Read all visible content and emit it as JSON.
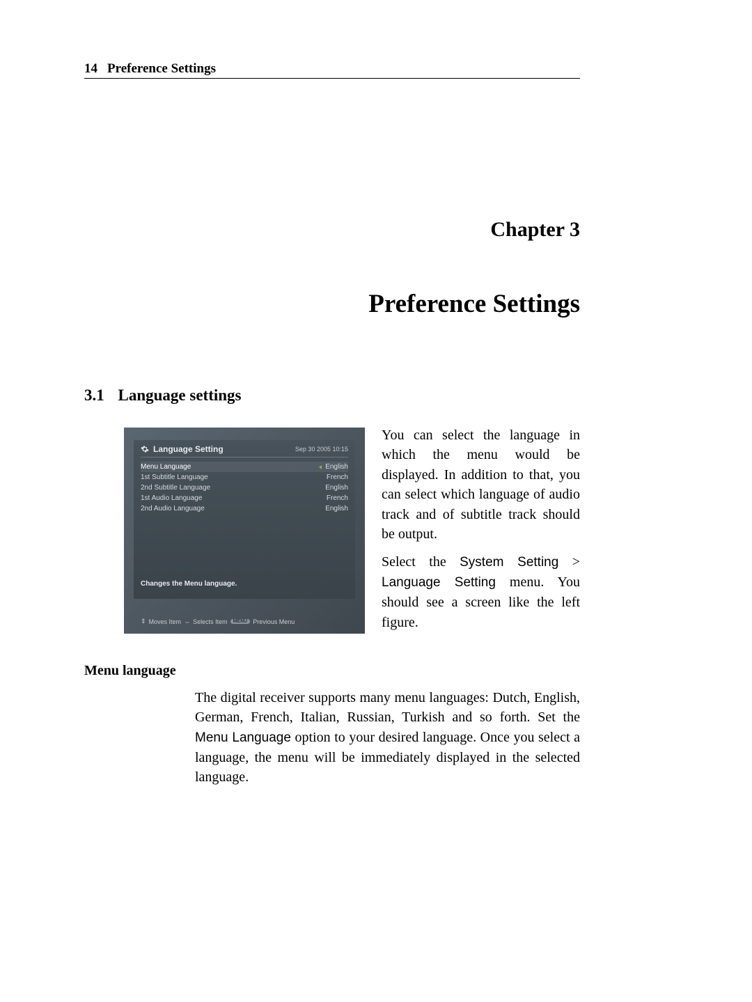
{
  "header": {
    "page_number": "14",
    "title": "Preference Settings"
  },
  "chapter": {
    "label": "Chapter 3",
    "title": "Preference Settings"
  },
  "section": {
    "number": "3.1",
    "title": "Language settings"
  },
  "screenshot": {
    "title": "Language Setting",
    "datetime": "Sep 30 2005 10:15",
    "rows": [
      {
        "label": "Menu Language",
        "value": "English",
        "selected": true
      },
      {
        "label": "1st Subtitle Language",
        "value": "French",
        "selected": false
      },
      {
        "label": "2nd Subtitle Language",
        "value": "English",
        "selected": false
      },
      {
        "label": "1st Audio Language",
        "value": "French",
        "selected": false
      },
      {
        "label": "2nd Audio Language",
        "value": "English",
        "selected": false
      }
    ],
    "help_text": "Changes the Menu language.",
    "footer": {
      "moves": "Moves Item",
      "selects": "Selects Item",
      "menu_badge": "MENU",
      "previous": "Previous Menu"
    }
  },
  "side_text": {
    "p1": "You can select the language in which the menu would be displayed. In addition to that, you can select which language of audio track and of subtitle track should be output.",
    "p2_a": "Select the ",
    "p2_menu1": "System Setting",
    "p2_gt": " > ",
    "p2_menu2": "Language Setting",
    "p2_b": " menu. You should see a screen like the left figure."
  },
  "subheading": "Menu language",
  "body_text": {
    "p1_a": "The digital receiver supports many menu languages: Dutch, English, German, French, Italian, Russian, Turkish and so forth. Set the ",
    "p1_menu": "Menu Language",
    "p1_b": " option to your desired language. Once you select a language, the menu will be immediately displayed in the selected language."
  }
}
